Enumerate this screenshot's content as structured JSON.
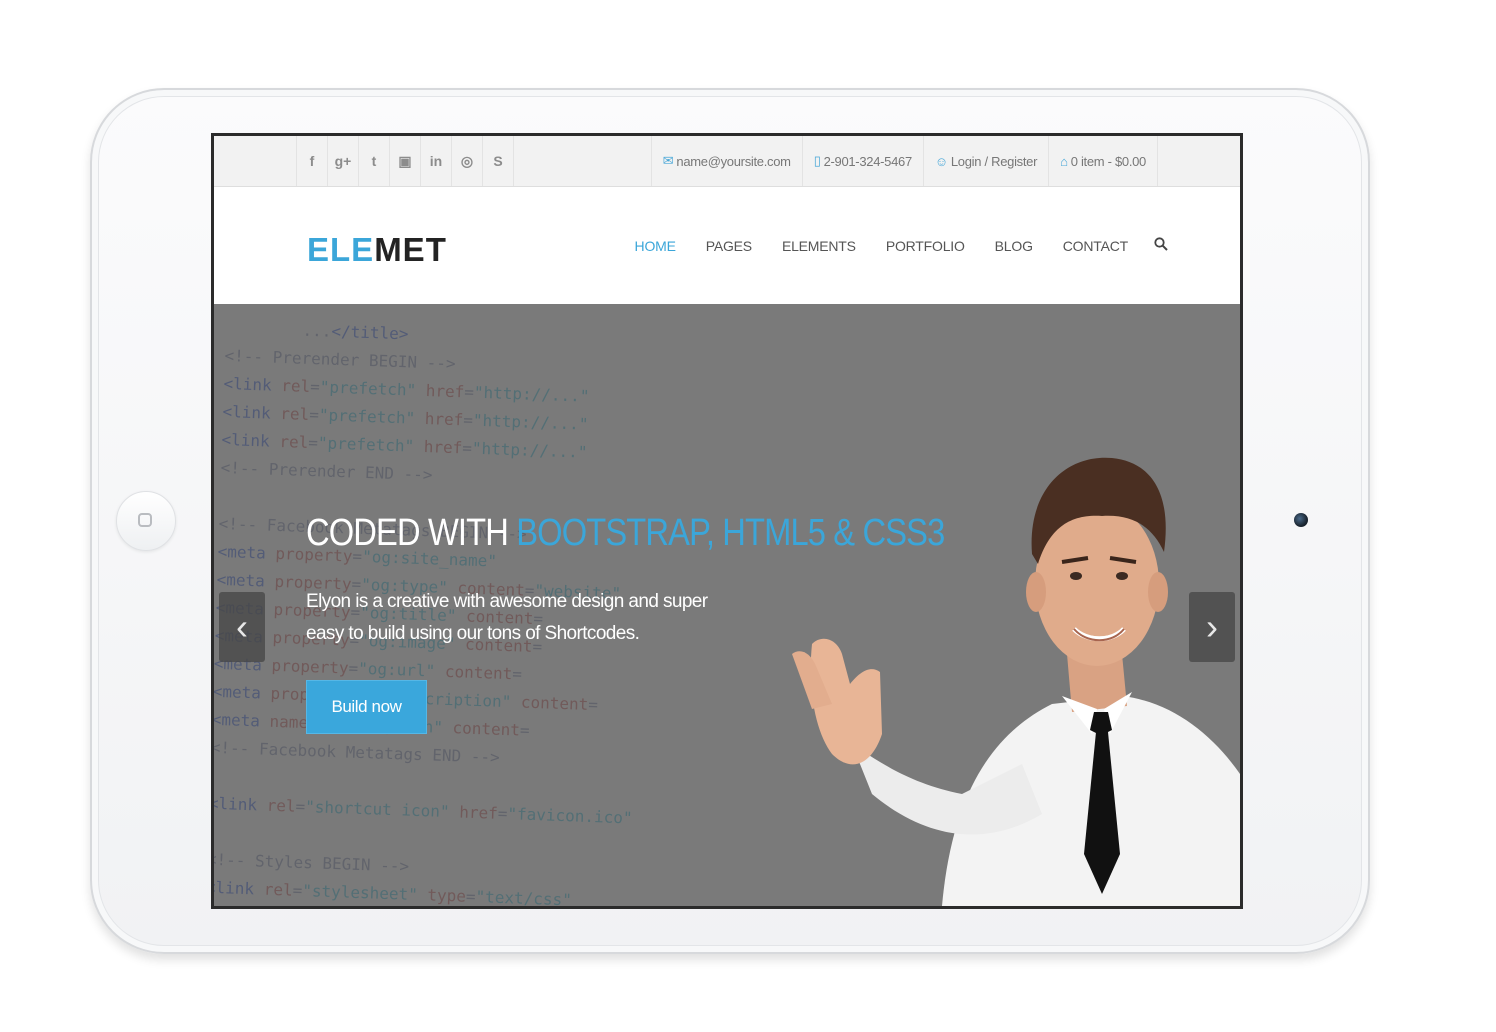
{
  "social": {
    "icons": [
      {
        "name": "facebook-icon",
        "glyph": "f"
      },
      {
        "name": "google-plus-icon",
        "glyph": "g+"
      },
      {
        "name": "twitter-icon",
        "glyph": "t"
      },
      {
        "name": "youtube-icon",
        "glyph": "▣"
      },
      {
        "name": "linkedin-icon",
        "glyph": "in"
      },
      {
        "name": "dribbble-icon",
        "glyph": "◎"
      },
      {
        "name": "skype-icon",
        "glyph": "S"
      }
    ]
  },
  "contact": {
    "email": "name@yoursite.com",
    "phone": "2-901-324-5467",
    "login": "Login / Register",
    "cart": "0 item - $0.00"
  },
  "brand": {
    "part1": "ELE",
    "part2": "MET",
    "accent_color": "#3ba6d9"
  },
  "nav": {
    "items": [
      "HOME",
      "PAGES",
      "ELEMENTS",
      "PORTFOLIO",
      "BLOG",
      "CONTACT"
    ],
    "active": "HOME"
  },
  "hero": {
    "headline_plain": "CODED WITH ",
    "headline_accent": "BOOTSTRAP, HTML5 & CSS3",
    "subtext": "Elyon is a creative with awesome design and super easy to build using our tons of Shortcodes.",
    "button_label": "Build now",
    "prev_glyph": "‹",
    "next_glyph": "›"
  }
}
